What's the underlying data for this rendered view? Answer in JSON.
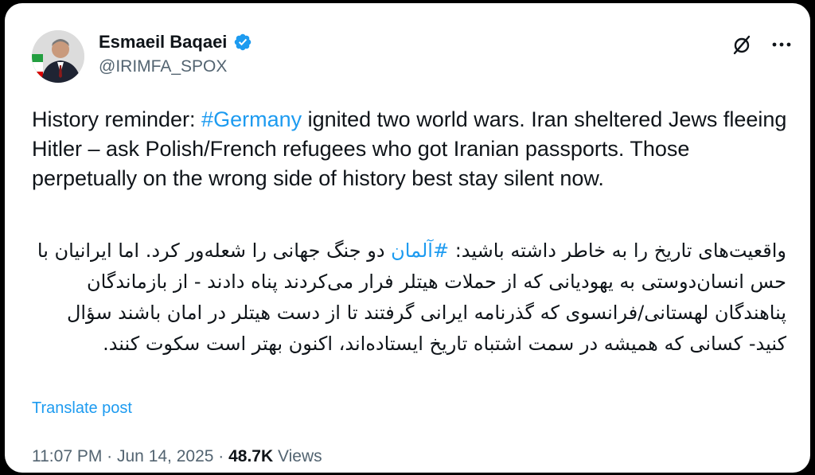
{
  "author": {
    "name": "Esmaeil Baqaei",
    "handle": "@IRIMFA_SPOX",
    "verified": true,
    "verified_color": "#1d9bf0"
  },
  "header_actions": {
    "grok_icon": "grok-slashed-circle-icon",
    "more_icon": "more-dots-icon"
  },
  "post": {
    "en_part1": "History reminder: ",
    "en_hashtag": "#Germany",
    "en_part2": " ignited two world wars. Iran sheltered Jews fleeing Hitler – ask Polish/French refugees who got Iranian passports. Those perpetually on the wrong side of history best stay silent now.",
    "fa_part1": "واقعیت‌های تاریخ را به خاطر داشته باشید: ",
    "fa_hashtag": "#آلمان",
    "fa_part2": " دو جنگ جهانی را شعله‌ور کرد. اما ایرانیان با حس انسان‌دوستی به یهودیانی که از حملات هیتلر فرار می‌کردند پناه دادند - از بازماندگان پناهندگان لهستانی/فرانسوی که گذرنامه ایرانی گرفتند تا از دست هیتلر در امان باشند سؤال کنید- کسانی که همیشه در سمت اشتباه تاریخ ایستاده‌اند، اکنون بهتر است سکوت کنند.",
    "hashtag_color": "#1d9bf0"
  },
  "translate_label": "Translate post",
  "meta": {
    "time": "11:07 PM",
    "separator": " · ",
    "date": "Jun 14, 2025",
    "views_count": "48.7K",
    "views_label": " Views"
  }
}
